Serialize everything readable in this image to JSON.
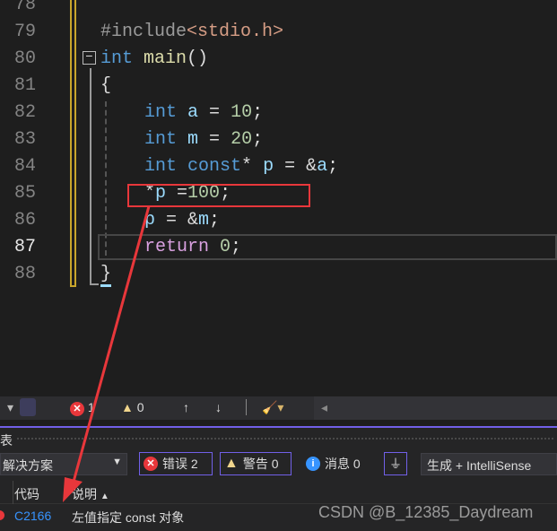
{
  "editor": {
    "line_numbers": [
      "78",
      "79",
      "80",
      "81",
      "82",
      "83",
      "84",
      "85",
      "86",
      "87",
      "88"
    ],
    "current_line": "87",
    "lines": {
      "l79": {
        "pp": "#include",
        "inc": "<stdio.h>"
      },
      "l80": {
        "kw": "int",
        "fn": "main",
        "rest": "()"
      },
      "l81": "{",
      "l82": {
        "kw": "int",
        "var": "a",
        "eq": " = ",
        "num": "10",
        "end": ";"
      },
      "l83": {
        "kw": "int",
        "var": "m",
        "eq": " = ",
        "num": "20",
        "end": ";"
      },
      "l84": {
        "kw": "int",
        "kw2": "const",
        "star": "*",
        "var": "p",
        "eq": " = &",
        "var2": "a",
        "end": ";"
      },
      "l85": {
        "star": "*",
        "var": "p",
        "eq": " =",
        "num": "100",
        "end": ";"
      },
      "l86": {
        "var": "p",
        "eq": " = &",
        "var2": "m",
        "end": ";"
      },
      "l87": {
        "ret": "return",
        "num": "0",
        "end": ";"
      },
      "l88": "}"
    }
  },
  "toolbar": {
    "errors_count": "1",
    "warnings_count": "0"
  },
  "panel": {
    "title_fragment": "表",
    "scope_dropdown": "解决方案",
    "errors_label": "错误 2",
    "warnings_label": "警告 0",
    "messages_label": "消息 0",
    "source_dropdown": "生成 + IntelliSense",
    "columns": {
      "code": "代码",
      "description": "说明"
    },
    "rows": [
      {
        "code": "C2166",
        "description": "左值指定 const 对象"
      }
    ]
  },
  "watermark": "CSDN @B_12385_Daydream",
  "colors": {
    "accent": "#7160e8",
    "error": "#e8373b",
    "warning": "#f0d58c",
    "info": "#3794ff"
  }
}
